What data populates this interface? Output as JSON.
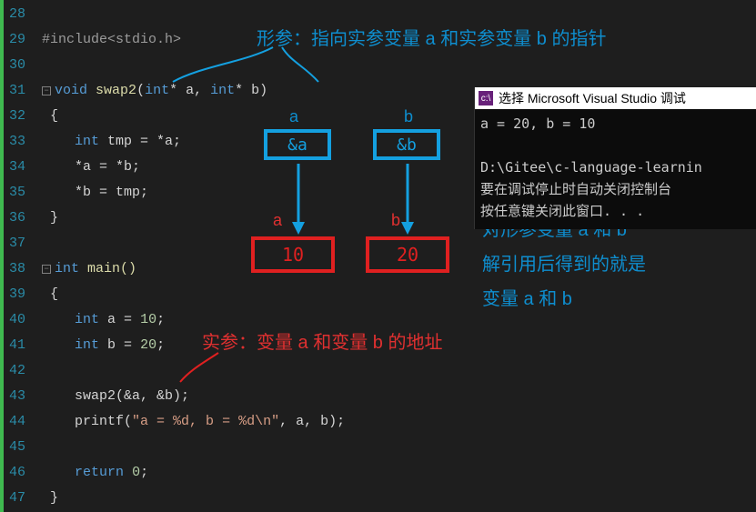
{
  "gutter": {
    "start": 28,
    "end": 47
  },
  "code": {
    "l28": "",
    "l29_include": "#include",
    "l29_hdr": "<stdio.h>",
    "l31_kw": "void",
    "l31_fn": "swap2",
    "l31_p": "(",
    "l31_t1": "int",
    "l31_s1": "* a, ",
    "l31_t2": "int",
    "l31_s2": "* b)",
    "l32": "{",
    "l33_a": "    ",
    "l33_t": "int",
    "l33_b": " tmp = *a;",
    "l34": "    *a = *b;",
    "l35": "    *b = tmp;",
    "l36": "}",
    "l38_kw": "int",
    "l38_fn": " main()",
    "l39": "{",
    "l40_a": "    ",
    "l40_t": "int",
    "l40_b": " a = ",
    "l40_n": "10",
    "l40_c": ";",
    "l41_a": "    ",
    "l41_t": "int",
    "l41_b": " b = ",
    "l41_n": "20",
    "l41_c": ";",
    "l43": "    swap2(&a, &b);",
    "l44_a": "    printf(",
    "l44_s": "\"a = %d, b = %d\\n\"",
    "l44_b": ", a, b);",
    "l46_a": "    ",
    "l46_kw": "return",
    "l46_b": " ",
    "l46_n": "0",
    "l46_c": ";",
    "l47": "}"
  },
  "annotations": {
    "formal_param": "形参：指向实参变量 a 和实参变量 b 的指针",
    "actual_param": "实参：变量 a 和变量 b 的地址",
    "label_a_top": "a",
    "label_b_top": "b",
    "addr_a": "&a",
    "addr_b": "&b",
    "label_a_mid": "a",
    "label_b_mid": "b",
    "val_a": "10",
    "val_b": "20",
    "explain1": "对形参变量 a 和 b",
    "explain2": "解引用后得到的就是",
    "explain3": "变量 a 和 b"
  },
  "console": {
    "title": "选择 Microsoft Visual Studio 调试",
    "out1": "a = 20, b = 10",
    "out2": "D:\\Gitee\\c-language-learnin",
    "out3": "要在调试停止时自动关闭控制台",
    "out4": "按任意键关闭此窗口. . ."
  }
}
